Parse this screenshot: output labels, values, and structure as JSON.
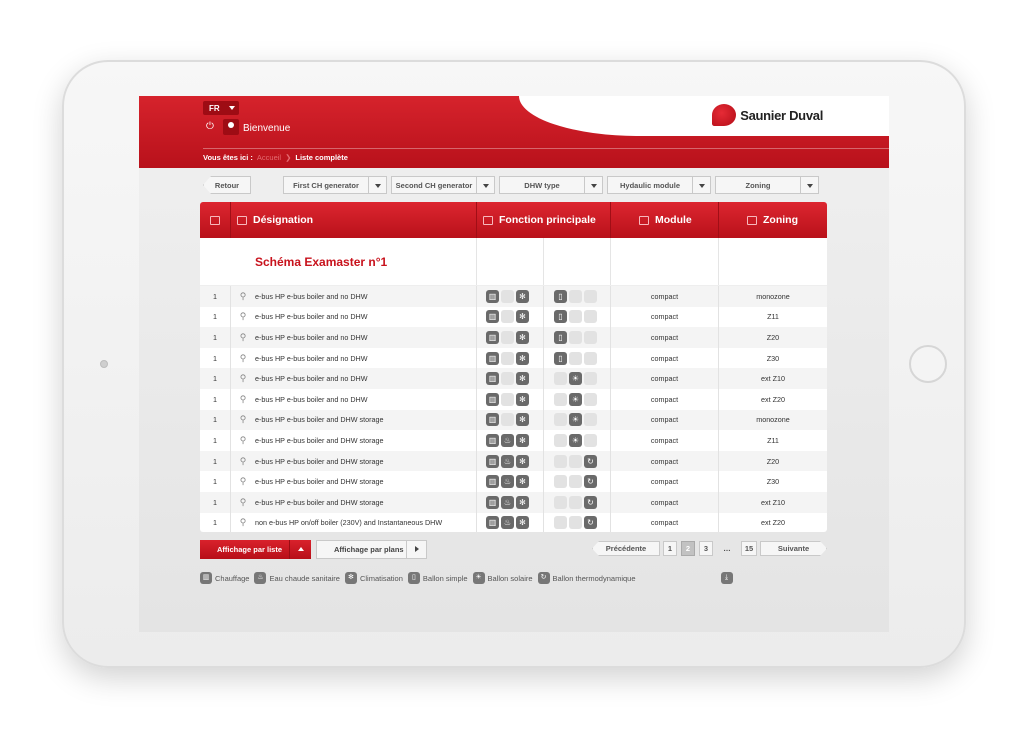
{
  "header": {
    "lang": "FR",
    "welcome": "Bienvenue",
    "brand": "Saunier Duval",
    "breadcrumb_prefix": "Vous êtes ici :",
    "breadcrumb_home": "Accueil",
    "breadcrumb_current": "Liste complète"
  },
  "toolbar": {
    "back": "Retour",
    "filters": [
      "First CH generator",
      "Second CH generator",
      "DHW type",
      "Hydaulic module",
      "Zoning"
    ]
  },
  "table": {
    "headers": {
      "designation": "Désignation",
      "fonction": "Fonction principale",
      "module": "Module",
      "zoning": "Zoning"
    },
    "schema_title": "Schéma Examaster n°1",
    "rows": [
      {
        "num": "1",
        "name": "e-bus HP e-bus boiler and no DHW",
        "module": "compact",
        "zoning": "monozone",
        "f1": [
          1,
          0,
          1
        ],
        "f2": [
          1,
          0,
          0
        ]
      },
      {
        "num": "1",
        "name": "e-bus HP e-bus boiler and no DHW",
        "module": "compact",
        "zoning": "Z11",
        "f1": [
          1,
          0,
          1
        ],
        "f2": [
          1,
          0,
          0
        ]
      },
      {
        "num": "1",
        "name": "e-bus HP e-bus boiler and no DHW",
        "module": "compact",
        "zoning": "Z20",
        "f1": [
          1,
          0,
          1
        ],
        "f2": [
          1,
          0,
          0
        ]
      },
      {
        "num": "1",
        "name": "e-bus HP e-bus boiler and no DHW",
        "module": "compact",
        "zoning": "Z30",
        "f1": [
          1,
          0,
          1
        ],
        "f2": [
          1,
          0,
          0
        ]
      },
      {
        "num": "1",
        "name": "e-bus HP e-bus boiler and no DHW",
        "module": "compact",
        "zoning": "ext Z10",
        "f1": [
          1,
          0,
          1
        ],
        "f2": [
          0,
          1,
          0
        ]
      },
      {
        "num": "1",
        "name": "e-bus HP e-bus boiler and no DHW",
        "module": "compact",
        "zoning": "ext Z20",
        "f1": [
          1,
          0,
          1
        ],
        "f2": [
          0,
          1,
          0
        ]
      },
      {
        "num": "1",
        "name": "e-bus HP e-bus boiler and DHW storage",
        "module": "compact",
        "zoning": "monozone",
        "f1": [
          1,
          0,
          1
        ],
        "f2": [
          0,
          1,
          0
        ]
      },
      {
        "num": "1",
        "name": "e-bus HP e-bus boiler and DHW storage",
        "module": "compact",
        "zoning": "Z11",
        "f1": [
          1,
          1,
          1
        ],
        "f2": [
          0,
          1,
          0
        ]
      },
      {
        "num": "1",
        "name": "e-bus HP e-bus boiler and DHW storage",
        "module": "compact",
        "zoning": "Z20",
        "f1": [
          1,
          1,
          1
        ],
        "f2": [
          0,
          0,
          1
        ]
      },
      {
        "num": "1",
        "name": "e-bus HP e-bus boiler and DHW storage",
        "module": "compact",
        "zoning": "Z30",
        "f1": [
          1,
          1,
          1
        ],
        "f2": [
          0,
          0,
          1
        ]
      },
      {
        "num": "1",
        "name": "e-bus HP e-bus boiler and DHW storage",
        "module": "compact",
        "zoning": "ext Z10",
        "f1": [
          1,
          1,
          1
        ],
        "f2": [
          0,
          0,
          1
        ]
      },
      {
        "num": "1",
        "name": "non e-bus HP on/off boiler (230V) and Instantaneous DHW",
        "module": "compact",
        "zoning": "ext Z20",
        "f1": [
          1,
          1,
          1
        ],
        "f2": [
          0,
          0,
          1
        ]
      }
    ]
  },
  "view": {
    "list": "Affichage par liste",
    "plans": "Affichage par plans"
  },
  "pagination": {
    "prev": "Précédente",
    "pages": [
      "1",
      "2",
      "3"
    ],
    "dots": "…",
    "last": "15",
    "next": "Suivante",
    "current": 2
  },
  "legend": [
    "Chauffage",
    "Eau chaude sanitaire",
    "Climatisation",
    "Ballon simple",
    "Ballon solaire",
    "Ballon thermodynamique"
  ],
  "colors": {
    "brand_red": "#c8121c",
    "icon_gray": "#6a6a6a"
  }
}
